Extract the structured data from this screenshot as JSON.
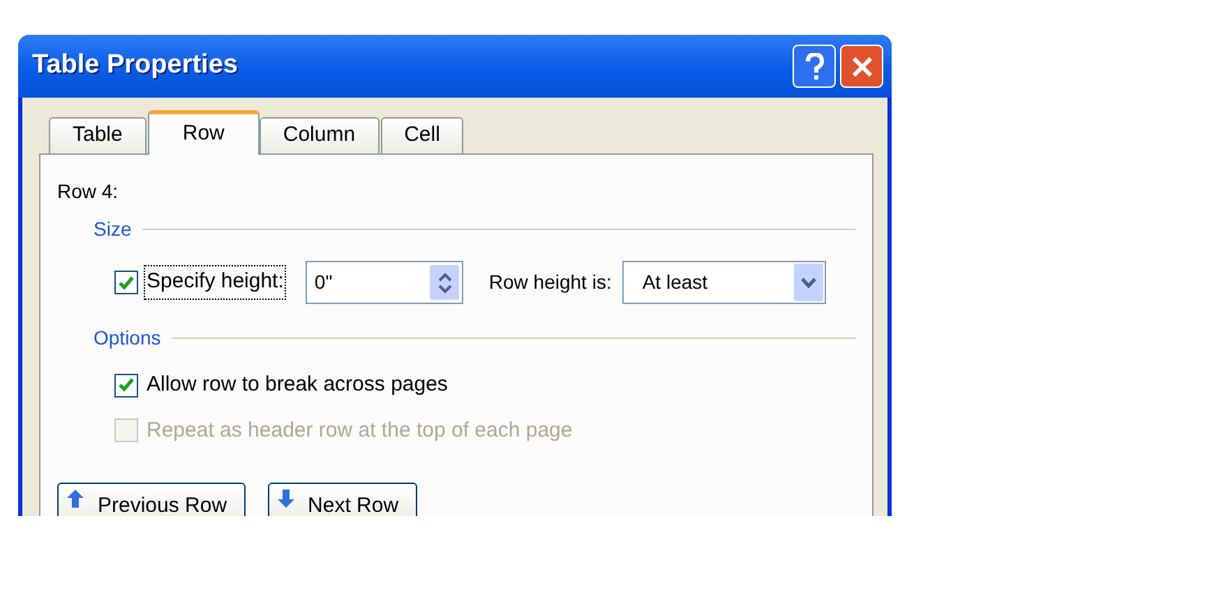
{
  "window": {
    "title": "Table Properties"
  },
  "tabs": [
    {
      "label": "Table",
      "selected": false
    },
    {
      "label": "Row",
      "selected": true
    },
    {
      "label": "Column",
      "selected": false
    },
    {
      "label": "Cell",
      "selected": false
    }
  ],
  "row_label": "Row 4:",
  "size_group": {
    "title": "Size",
    "specify_height": {
      "label": "Specify height:",
      "checked": true
    },
    "height_field": {
      "value": "0\""
    },
    "row_height_label": "Row height is:",
    "row_height_select": {
      "value": "At least"
    }
  },
  "options_group": {
    "title": "Options",
    "checkboxes": [
      {
        "label": "Allow row to break across pages",
        "checked": true,
        "disabled": false
      },
      {
        "label": "Repeat as header row at the top of each page",
        "checked": false,
        "disabled": true
      }
    ]
  },
  "buttons": [
    {
      "label": "Previous Row",
      "kind": "up"
    },
    {
      "label": "Next Row",
      "kind": "down"
    }
  ]
}
